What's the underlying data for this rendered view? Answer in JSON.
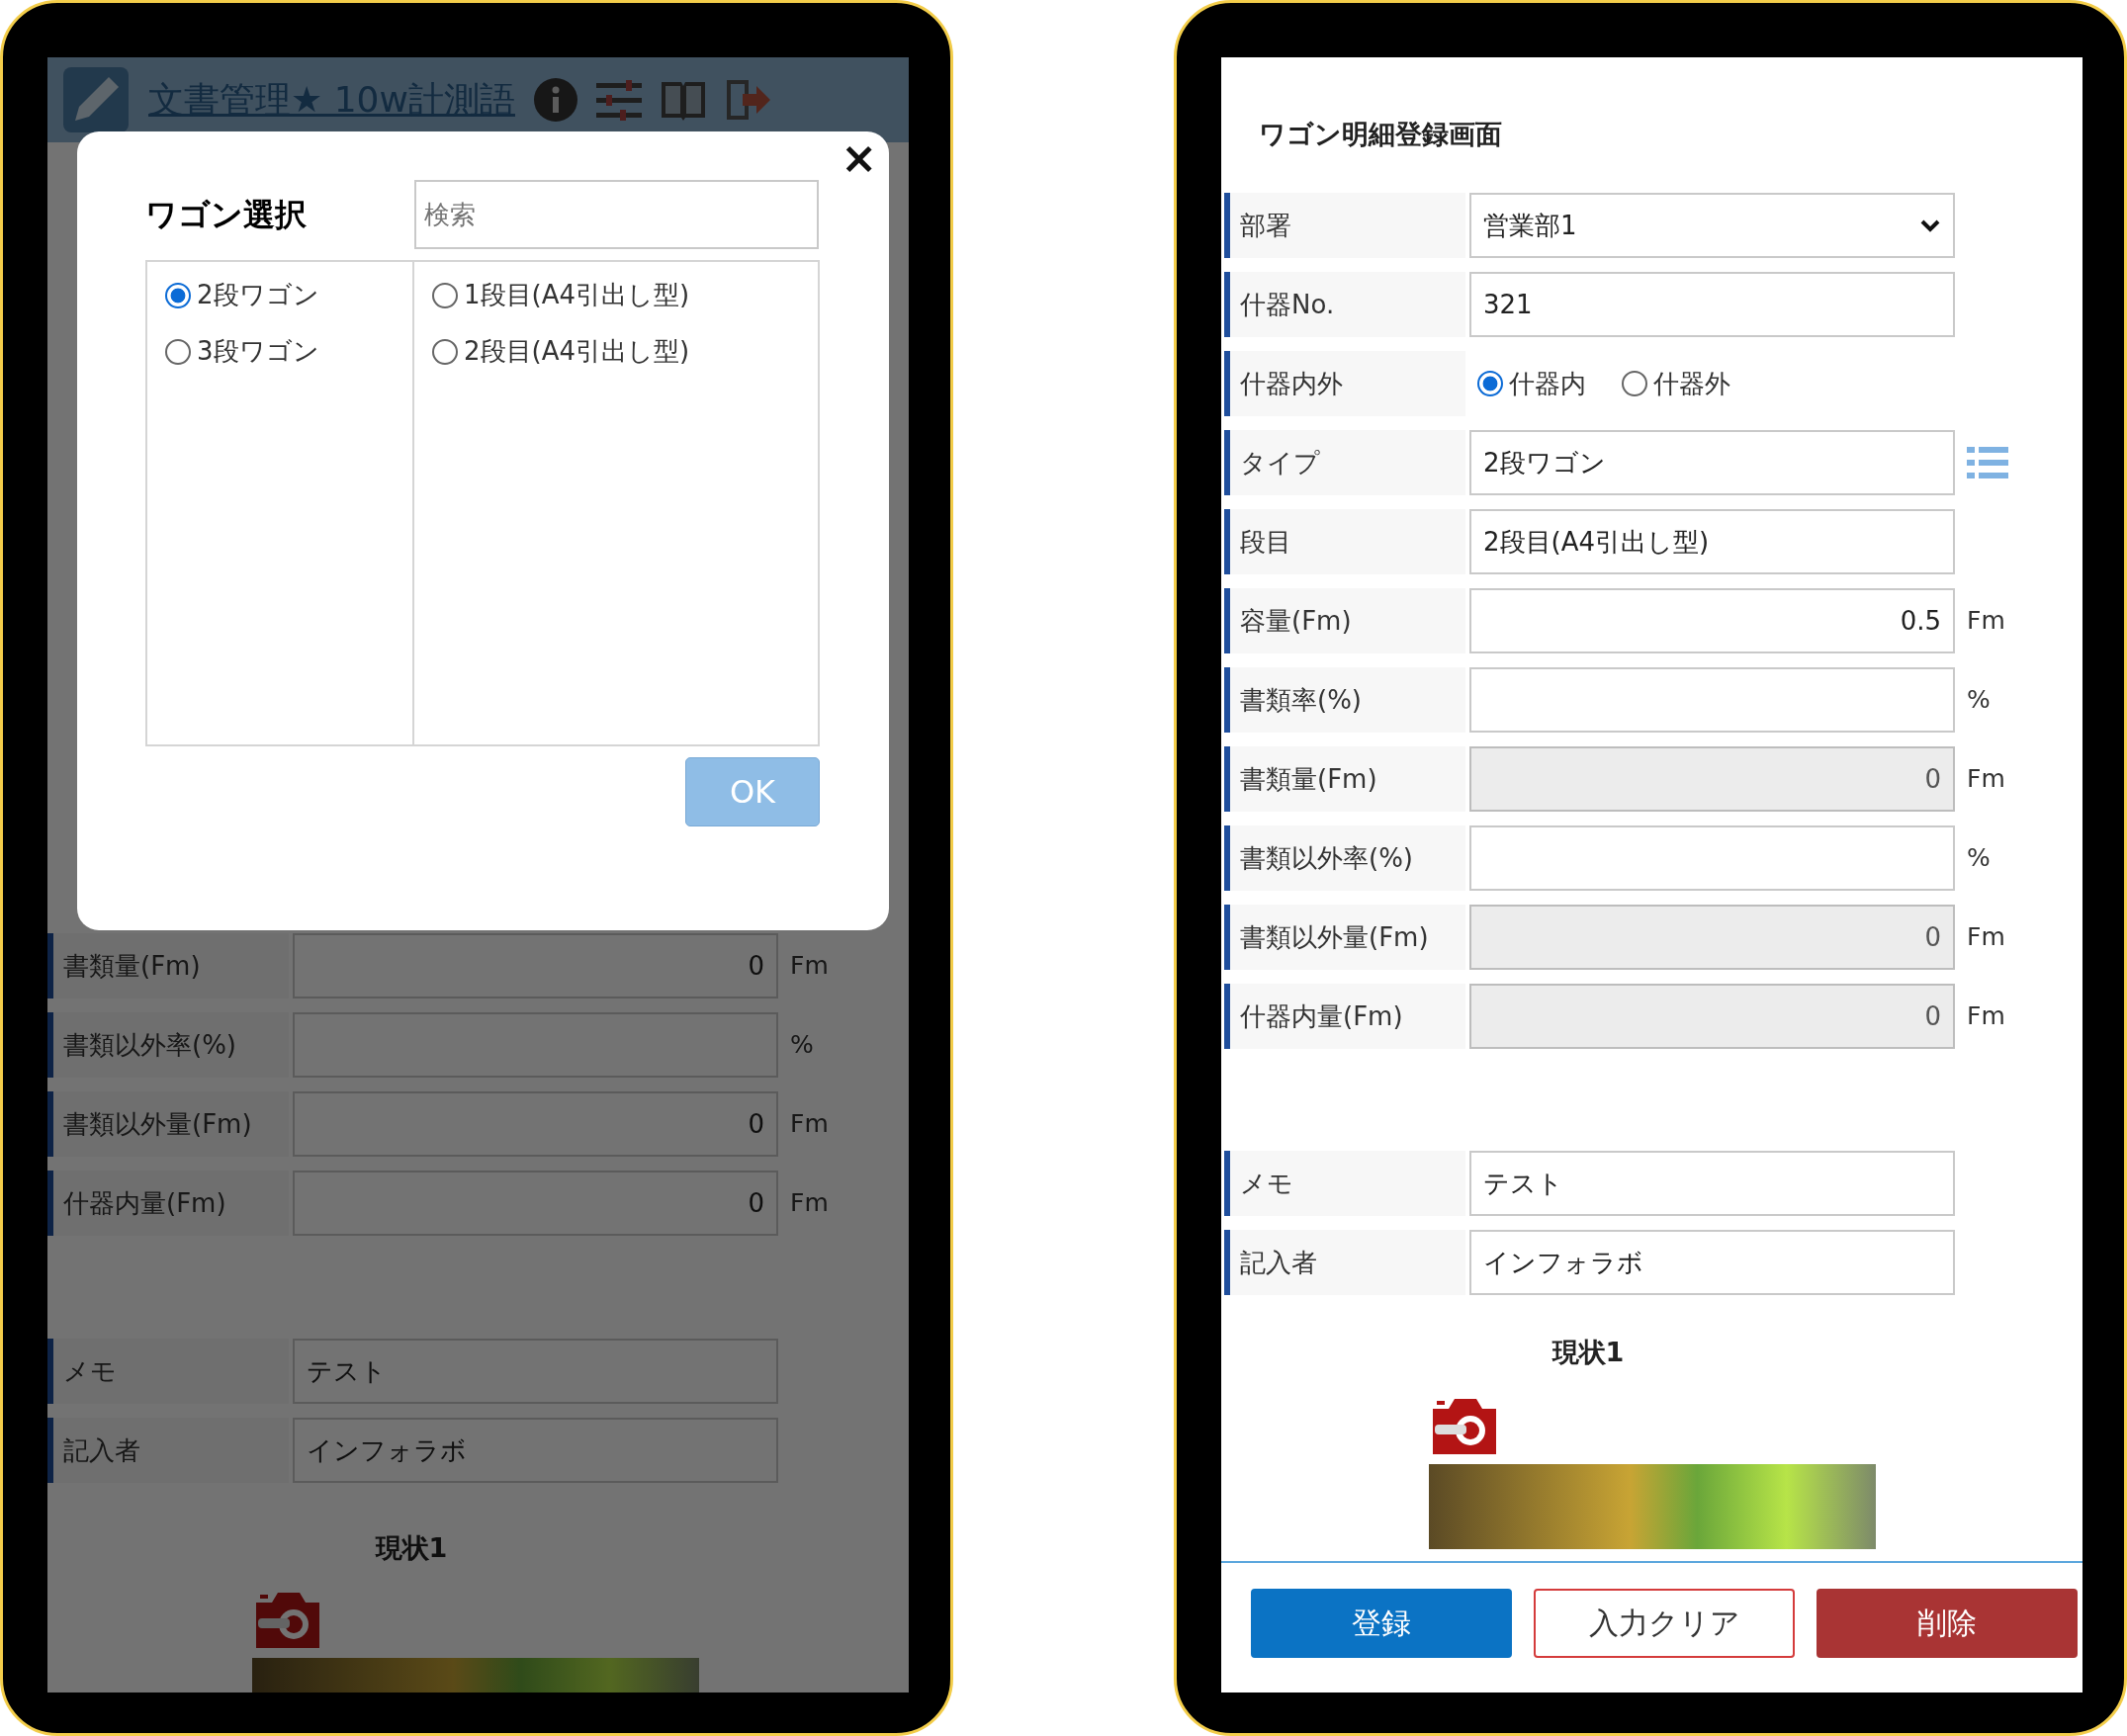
{
  "left_phone": {
    "app_bar": {
      "title": "文書管理★ 10w計測語"
    },
    "form_rows": [
      {
        "kind": "number",
        "label": "書類量(Fm)",
        "value": "0",
        "unit": "Fm"
      },
      {
        "kind": "number",
        "label": "書類以外率(%)",
        "unit": "%"
      },
      {
        "kind": "number",
        "label": "書類以外量(Fm)",
        "value": "0",
        "unit": "Fm"
      },
      {
        "kind": "number",
        "label": "什器内量(Fm)",
        "value": "0",
        "unit": "Fm"
      }
    ],
    "memo_rows": [
      {
        "kind": "text",
        "label": "メモ",
        "value": "テスト"
      },
      {
        "kind": "text",
        "label": "記入者",
        "value": "インフォラボ"
      }
    ],
    "photo_section": {
      "title": "現状1"
    },
    "dialog": {
      "title": "ワゴン選択",
      "search": {
        "placeholder": "検索"
      },
      "wagon_types": [
        {
          "label": "2段ワゴン",
          "selected": true
        },
        {
          "label": "3段ワゴン",
          "selected": false
        }
      ],
      "tiers": [
        {
          "label": "1段目(A4引出し型)",
          "selected": false
        },
        {
          "label": "2段目(A4引出し型)",
          "selected": false
        }
      ],
      "ok_button": "OK",
      "close_button": "×"
    }
  },
  "right_phone": {
    "title": "ワゴン明細登録画面",
    "form_rows": [
      {
        "kind": "select",
        "label": "部署",
        "value": "営業部1"
      },
      {
        "kind": "text",
        "label": "什器No.",
        "value": "321",
        "readonly": false
      },
      {
        "kind": "radio",
        "label": "什器内外",
        "options": [
          {
            "label": "什器内",
            "selected": true
          },
          {
            "label": "什器外",
            "selected": false
          }
        ]
      },
      {
        "kind": "picker",
        "label": "タイプ",
        "value": "2段ワゴン",
        "readonly": false
      },
      {
        "kind": "text",
        "label": "段目",
        "value": "2段目(A4引出し型)",
        "readonly": false
      },
      {
        "kind": "number",
        "label": "容量(Fm)",
        "value": "0.5",
        "unit": "Fm",
        "readonly": false
      },
      {
        "kind": "number",
        "label": "書類率(%)",
        "unit": "%",
        "readonly": false
      },
      {
        "kind": "number",
        "label": "書類量(Fm)",
        "value": "0",
        "unit": "Fm",
        "readonly": true
      },
      {
        "kind": "number",
        "label": "書類以外率(%)",
        "unit": "%",
        "readonly": false
      },
      {
        "kind": "number",
        "label": "書類以外量(Fm)",
        "value": "0",
        "unit": "Fm",
        "readonly": true
      },
      {
        "kind": "number",
        "label": "什器内量(Fm)",
        "value": "0",
        "unit": "Fm",
        "readonly": true
      }
    ],
    "memo_rows": [
      {
        "kind": "text",
        "label": "メモ",
        "value": "テスト",
        "readonly": false
      },
      {
        "kind": "text",
        "label": "記入者",
        "value": "インフォラボ",
        "readonly": false
      }
    ],
    "photo_section": {
      "title": "現状1"
    },
    "buttons": [
      {
        "label": "登録",
        "kind": "primary"
      },
      {
        "label": "入力クリア",
        "kind": "outline"
      },
      {
        "label": "削除",
        "kind": "danger"
      }
    ]
  }
}
